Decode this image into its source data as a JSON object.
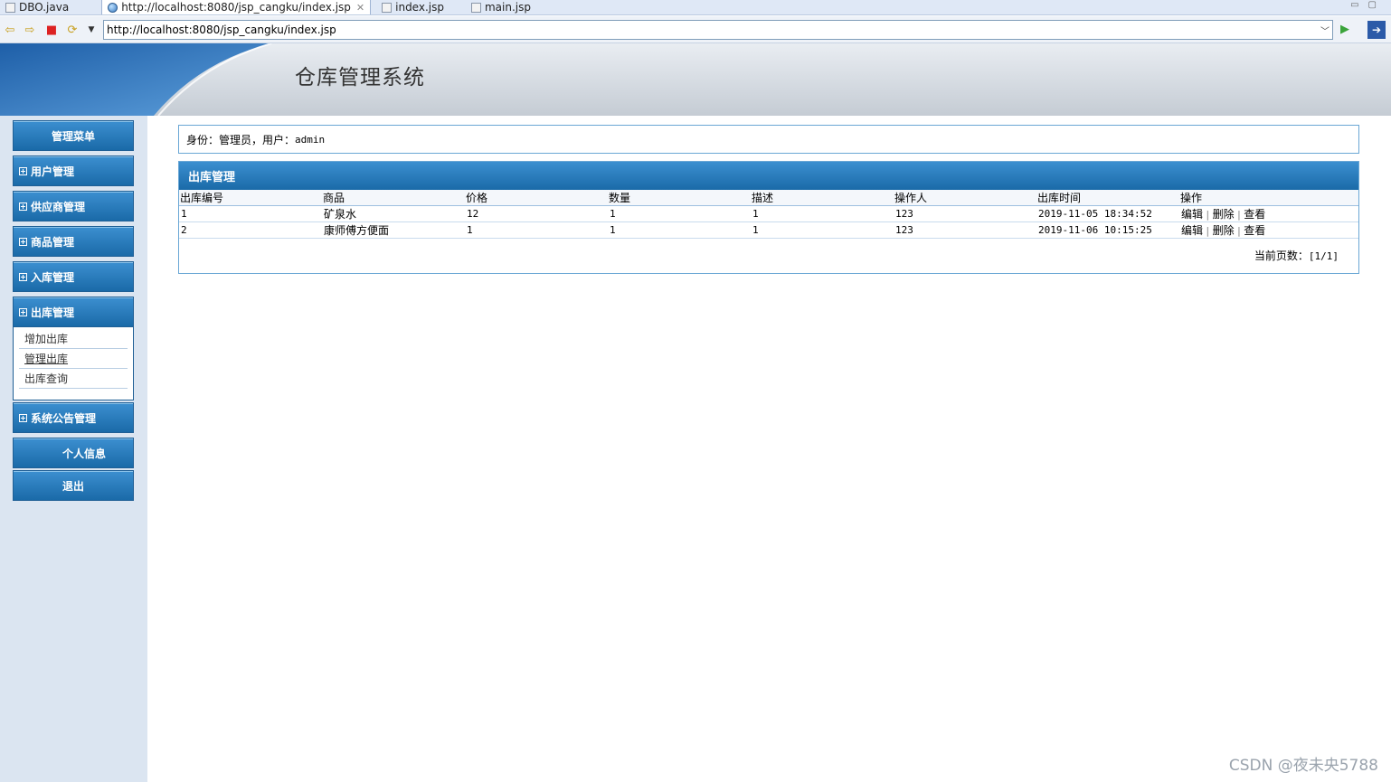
{
  "editor_tabs": [
    {
      "label": "DBO.java"
    },
    {
      "label": "http://localhost:8080/jsp_cangku/index.jsp",
      "active": true
    },
    {
      "label": "index.jsp"
    },
    {
      "label": "main.jsp"
    }
  ],
  "browser": {
    "url": "http://localhost:8080/jsp_cangku/index.jsp"
  },
  "header": {
    "title": "仓库管理系统"
  },
  "sidebar": {
    "menu_title": "管理菜单",
    "groups": [
      {
        "label": "用户管理"
      },
      {
        "label": "供应商管理"
      },
      {
        "label": "商品管理"
      },
      {
        "label": "入库管理"
      },
      {
        "label": "出库管理",
        "expanded": true
      }
    ],
    "submenu": [
      {
        "label": "增加出库"
      },
      {
        "label": "管理出库"
      },
      {
        "label": "出库查询"
      }
    ],
    "notice_group": "系统公告管理",
    "profile": "个人信息",
    "logout": "退出"
  },
  "user_info": {
    "prefix": "身份：管理员，用户：",
    "username": "admin"
  },
  "panel": {
    "title": "出库管理",
    "columns": [
      "出库编号",
      "商品",
      "价格",
      "数量",
      "描述",
      "操作人",
      "出库时间",
      "操作"
    ],
    "rows": [
      {
        "id": "1",
        "product": "矿泉水",
        "price": "12",
        "qty": "1",
        "desc": "1",
        "operator": "123",
        "time": "2019-11-05 18:34:52"
      },
      {
        "id": "2",
        "product": "康师傅方便面",
        "price": "1",
        "qty": "1",
        "desc": "1",
        "operator": "123",
        "time": "2019-11-06 10:15:25"
      }
    ],
    "actions": {
      "edit": "编辑",
      "delete": "删除",
      "view": "查看"
    },
    "pager_label": "当前页数：",
    "pager_value": "[1/1]"
  },
  "watermark": "CSDN @夜未央5788",
  "colors": {
    "accent": "#1a6aa8",
    "sidebar_bg": "#dbe5f1",
    "border": "#6aa7d5"
  },
  "icons": [
    "back-icon",
    "forward-icon",
    "stop-icon",
    "refresh-icon",
    "go-icon",
    "globe-icon",
    "file-icon",
    "close-icon",
    "plus-icon"
  ]
}
